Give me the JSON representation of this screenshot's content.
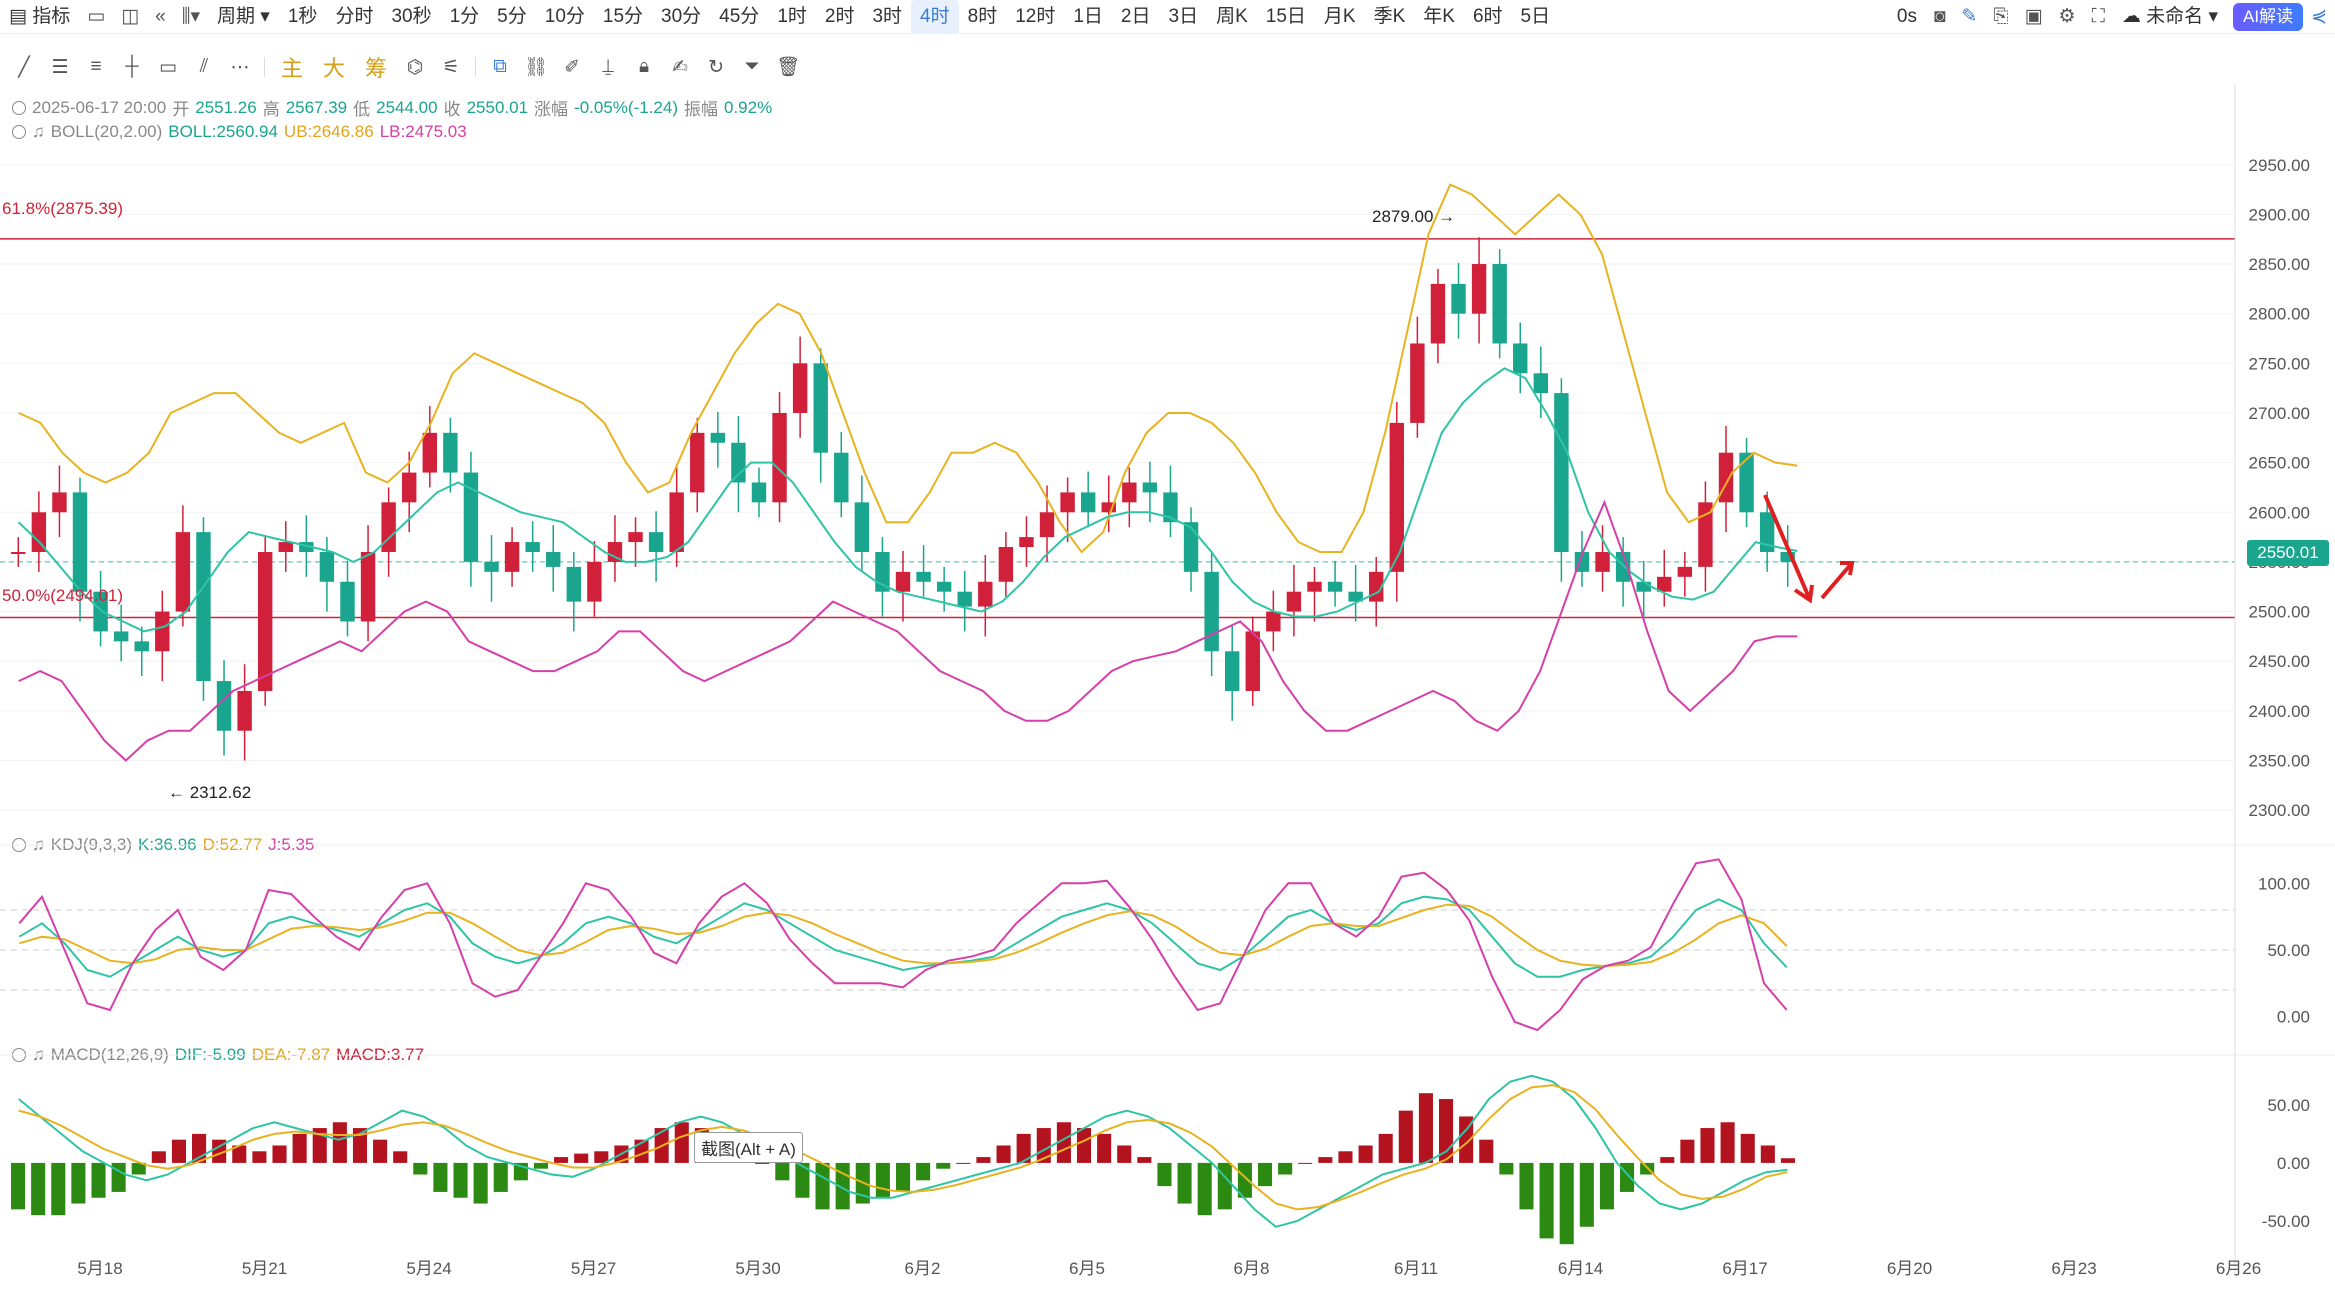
{
  "toolbar": {
    "indicator": "指标",
    "period": "周期",
    "intervals": [
      "1秒",
      "分时",
      "30秒",
      "1分",
      "5分",
      "10分",
      "15分",
      "30分",
      "45分",
      "1时",
      "2时",
      "3时",
      "4时",
      "8时",
      "12时",
      "1日",
      "2日",
      "3日",
      "周K",
      "15日",
      "月K",
      "季K",
      "年K",
      "6时",
      "5日"
    ],
    "active_interval": "4时",
    "timer": "0s",
    "unnamed": "未命名",
    "ai_label": "AI解读",
    "modes": [
      "主",
      "大",
      "筹"
    ]
  },
  "ohlc": {
    "datetime": "2025-06-17 20:00",
    "open_label": "开",
    "open": "2551.26",
    "high_label": "高",
    "high": "2567.39",
    "low_label": "低",
    "low": "2544.00",
    "close_label": "收",
    "close": "2550.01",
    "change_label": "涨幅",
    "change": "-0.05%(-1.24)",
    "amp_label": "振幅",
    "amp": "0.92%"
  },
  "boll": {
    "name": "BOLL(20,2.00)",
    "mid": "BOLL:2560.94",
    "ub": "UB:2646.86",
    "lb": "LB:2475.03"
  },
  "kdj": {
    "name": "KDJ(9,3,3)",
    "k": "K:36.96",
    "d": "D:52.77",
    "j": "J:5.35"
  },
  "macd": {
    "name": "MACD(12,26,9)",
    "dif": "DIF:-5.99",
    "dea": "DEA:-7.87",
    "macd": "MACD:3.77"
  },
  "fib": {
    "upper": "61.8%(2875.39)",
    "lower": "50.0%(2494.01)"
  },
  "annotations": {
    "high": "2879.00 →",
    "low": "← 2312.62",
    "last_price": "2550.01",
    "screenshot_tip": "截图(Alt + A)"
  },
  "colors": {
    "up": "#d1213a",
    "down": "#1aa58e",
    "mid": "#2ec4a5",
    "ub": "#e8b320",
    "lb": "#d63fa9",
    "kline": "#2ec4a5",
    "dline": "#e8b320",
    "jline": "#d63fa9"
  },
  "chart_data": [
    {
      "type": "candlestick",
      "title": "",
      "x_tick_labels": [
        "5月18",
        "5月21",
        "5月24",
        "5月27",
        "5月30",
        "6月2",
        "6月5",
        "6月8",
        "6月11",
        "6月14",
        "6月17",
        "6月20",
        "6月23",
        "6月26"
      ],
      "y_ticks": [
        2300,
        2350,
        2400,
        2450,
        2500,
        2550,
        2600,
        2650,
        2700,
        2750,
        2800,
        2850,
        2900,
        2950
      ],
      "ylim": [
        2280,
        2985
      ],
      "series_close": [
        2560,
        2600,
        2620,
        2520,
        2480,
        2470,
        2460,
        2500,
        2580,
        2430,
        2380,
        2420,
        2560,
        2570,
        2560,
        2530,
        2490,
        2560,
        2610,
        2640,
        2680,
        2640,
        2550,
        2540,
        2570,
        2560,
        2545,
        2510,
        2550,
        2570,
        2580,
        2560,
        2620,
        2680,
        2670,
        2630,
        2610,
        2700,
        2750,
        2660,
        2610,
        2560,
        2520,
        2540,
        2530,
        2520,
        2505,
        2530,
        2565,
        2575,
        2600,
        2620,
        2600,
        2610,
        2630,
        2620,
        2590,
        2540,
        2460,
        2420,
        2480,
        2500,
        2520,
        2530,
        2520,
        2510,
        2540,
        2690,
        2770,
        2830,
        2800,
        2850,
        2770,
        2740,
        2720,
        2560,
        2540,
        2560,
        2530,
        2520,
        2535,
        2545,
        2610,
        2660,
        2600,
        2560,
        2550
      ],
      "boll_mid": [
        2590,
        2570,
        2545,
        2520,
        2500,
        2490,
        2480,
        2485,
        2500,
        2530,
        2560,
        2580,
        2575,
        2570,
        2565,
        2560,
        2550,
        2560,
        2580,
        2600,
        2620,
        2630,
        2620,
        2610,
        2600,
        2595,
        2590,
        2575,
        2560,
        2550,
        2550,
        2555,
        2570,
        2600,
        2630,
        2650,
        2650,
        2630,
        2600,
        2570,
        2545,
        2530,
        2520,
        2515,
        2510,
        2505,
        2500,
        2510,
        2530,
        2555,
        2575,
        2585,
        2595,
        2600,
        2600,
        2595,
        2585,
        2560,
        2530,
        2510,
        2500,
        2495,
        2495,
        2500,
        2510,
        2520,
        2560,
        2620,
        2680,
        2710,
        2730,
        2745,
        2735,
        2700,
        2660,
        2600,
        2560,
        2540,
        2525,
        2515,
        2512,
        2520,
        2545,
        2570,
        2565,
        2561
      ],
      "boll_ub": [
        2700,
        2690,
        2660,
        2640,
        2630,
        2640,
        2660,
        2700,
        2710,
        2720,
        2720,
        2700,
        2680,
        2670,
        2680,
        2690,
        2640,
        2630,
        2650,
        2690,
        2740,
        2760,
        2750,
        2740,
        2730,
        2720,
        2710,
        2690,
        2650,
        2620,
        2630,
        2680,
        2720,
        2760,
        2790,
        2810,
        2800,
        2760,
        2700,
        2640,
        2590,
        2590,
        2620,
        2660,
        2660,
        2670,
        2660,
        2630,
        2590,
        2560,
        2580,
        2640,
        2680,
        2700,
        2700,
        2690,
        2670,
        2640,
        2600,
        2570,
        2560,
        2560,
        2600,
        2680,
        2780,
        2880,
        2930,
        2920,
        2900,
        2880,
        2900,
        2920,
        2900,
        2860,
        2780,
        2700,
        2620,
        2590,
        2600,
        2640,
        2660,
        2650,
        2647
      ],
      "boll_lb": [
        2430,
        2440,
        2430,
        2400,
        2370,
        2350,
        2370,
        2380,
        2380,
        2400,
        2420,
        2430,
        2440,
        2450,
        2460,
        2470,
        2460,
        2480,
        2500,
        2510,
        2500,
        2470,
        2460,
        2450,
        2440,
        2440,
        2450,
        2460,
        2480,
        2480,
        2460,
        2440,
        2430,
        2440,
        2450,
        2460,
        2470,
        2490,
        2510,
        2500,
        2490,
        2480,
        2460,
        2440,
        2430,
        2420,
        2400,
        2390,
        2390,
        2400,
        2420,
        2440,
        2450,
        2455,
        2460,
        2470,
        2480,
        2490,
        2470,
        2430,
        2400,
        2380,
        2380,
        2390,
        2400,
        2410,
        2420,
        2410,
        2390,
        2380,
        2400,
        2440,
        2500,
        2560,
        2610,
        2550,
        2480,
        2420,
        2400,
        2420,
        2440,
        2470,
        2475,
        2475
      ]
    },
    {
      "type": "line",
      "title": "KDJ(9,3,3)",
      "y_ticks": [
        0,
        50,
        100
      ],
      "ylim": [
        -10,
        110
      ],
      "series": [
        {
          "name": "K",
          "values": [
            60,
            70,
            55,
            35,
            30,
            40,
            50,
            60,
            50,
            45,
            50,
            70,
            75,
            70,
            65,
            60,
            70,
            80,
            85,
            75,
            55,
            45,
            40,
            45,
            55,
            70,
            75,
            70,
            60,
            55,
            65,
            75,
            85,
            80,
            70,
            60,
            50,
            45,
            40,
            35,
            38,
            40,
            42,
            45,
            55,
            65,
            75,
            80,
            85,
            80,
            70,
            55,
            40,
            35,
            45,
            60,
            75,
            80,
            70,
            65,
            70,
            85,
            90,
            88,
            80,
            60,
            40,
            30,
            30,
            35,
            38,
            40,
            45,
            60,
            80,
            88,
            80,
            55,
            37
          ]
        },
        {
          "name": "D",
          "values": [
            55,
            60,
            58,
            50,
            42,
            40,
            43,
            50,
            52,
            50,
            50,
            58,
            66,
            68,
            67,
            65,
            67,
            72,
            78,
            78,
            70,
            60,
            50,
            46,
            48,
            56,
            65,
            68,
            66,
            62,
            63,
            68,
            75,
            78,
            76,
            70,
            62,
            55,
            48,
            42,
            40,
            40,
            41,
            43,
            48,
            55,
            63,
            70,
            76,
            79,
            76,
            68,
            57,
            48,
            46,
            51,
            60,
            68,
            70,
            68,
            68,
            74,
            80,
            84,
            83,
            75,
            62,
            50,
            42,
            39,
            38,
            39,
            41,
            48,
            58,
            70,
            76,
            70,
            53
          ]
        },
        {
          "name": "J",
          "values": [
            70,
            90,
            50,
            10,
            5,
            40,
            65,
            80,
            45,
            35,
            50,
            95,
            92,
            75,
            60,
            50,
            75,
            95,
            100,
            70,
            25,
            15,
            20,
            45,
            70,
            100,
            95,
            75,
            48,
            40,
            70,
            90,
            100,
            85,
            58,
            40,
            25,
            25,
            25,
            22,
            35,
            42,
            45,
            50,
            70,
            85,
            100,
            100,
            102,
            82,
            58,
            30,
            5,
            10,
            45,
            80,
            100,
            100,
            70,
            60,
            75,
            105,
            108,
            95,
            72,
            30,
            -4,
            -10,
            5,
            28,
            38,
            42,
            52,
            85,
            115,
            118,
            88,
            25,
            5
          ]
        }
      ]
    },
    {
      "type": "bar",
      "title": "MACD(12,26,9)",
      "y_ticks": [
        -50,
        0,
        50
      ],
      "ylim": [
        -75,
        80
      ],
      "series": [
        {
          "name": "MACD",
          "values": [
            -40,
            -45,
            -45,
            -35,
            -30,
            -25,
            -10,
            10,
            20,
            25,
            20,
            15,
            10,
            15,
            25,
            30,
            35,
            30,
            20,
            10,
            -10,
            -25,
            -30,
            -35,
            -25,
            -15,
            -5,
            5,
            8,
            10,
            15,
            20,
            30,
            35,
            30,
            20,
            10,
            0,
            -15,
            -30,
            -40,
            -40,
            -35,
            -30,
            -25,
            -15,
            -5,
            0,
            5,
            15,
            25,
            30,
            35,
            30,
            25,
            15,
            5,
            -20,
            -35,
            -45,
            -40,
            -30,
            -20,
            -10,
            0,
            5,
            10,
            15,
            25,
            45,
            60,
            55,
            40,
            20,
            -10,
            -40,
            -65,
            -70,
            -55,
            -40,
            -25,
            -10,
            5,
            20,
            30,
            35,
            25,
            15,
            4
          ]
        },
        {
          "name": "DIF",
          "values": [
            55,
            40,
            25,
            10,
            0,
            -10,
            -15,
            -10,
            0,
            10,
            20,
            30,
            35,
            30,
            25,
            20,
            25,
            35,
            45,
            40,
            30,
            15,
            5,
            0,
            -5,
            -10,
            -12,
            -5,
            5,
            15,
            25,
            35,
            40,
            35,
            25,
            15,
            5,
            -5,
            -15,
            -25,
            -30,
            -30,
            -25,
            -20,
            -15,
            -10,
            -5,
            0,
            10,
            20,
            30,
            40,
            45,
            40,
            30,
            15,
            0,
            -20,
            -40,
            -55,
            -50,
            -40,
            -30,
            -20,
            -10,
            -5,
            0,
            10,
            30,
            55,
            70,
            75,
            70,
            55,
            30,
            0,
            -20,
            -35,
            -40,
            -35,
            -25,
            -15,
            -8,
            -6
          ]
        },
        {
          "name": "DEA",
          "values": [
            45,
            40,
            32,
            22,
            12,
            5,
            -2,
            -5,
            -2,
            5,
            12,
            20,
            25,
            27,
            25,
            24,
            24,
            28,
            33,
            35,
            32,
            25,
            17,
            10,
            5,
            0,
            -4,
            -4,
            0,
            6,
            13,
            22,
            28,
            31,
            28,
            22,
            15,
            6,
            -3,
            -12,
            -20,
            -24,
            -25,
            -23,
            -19,
            -14,
            -9,
            -4,
            3,
            11,
            19,
            28,
            35,
            37,
            34,
            26,
            14,
            -3,
            -20,
            -35,
            -40,
            -38,
            -32,
            -25,
            -17,
            -10,
            -5,
            3,
            18,
            38,
            55,
            65,
            67,
            61,
            46,
            24,
            4,
            -15,
            -27,
            -31,
            -29,
            -22,
            -12,
            -8
          ]
        }
      ]
    }
  ]
}
